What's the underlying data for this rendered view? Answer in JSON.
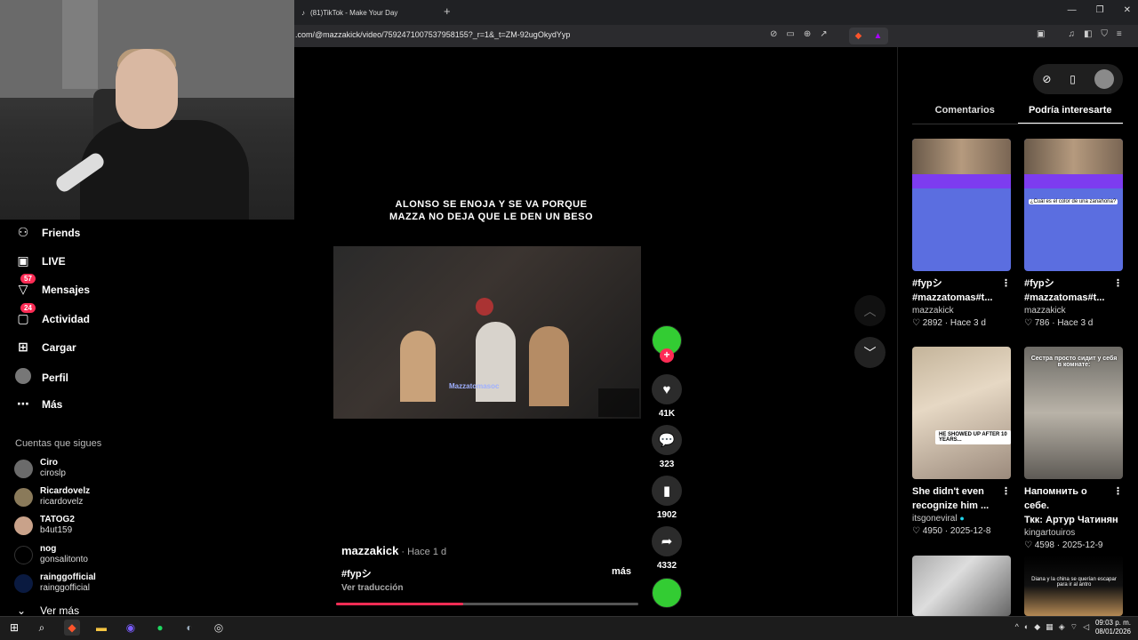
{
  "browser": {
    "tab_title": "(81)TikTok - Make Your Day",
    "url": ".com/@mazzakick/video/7592471007537958155?_r=1&_t=ZM-92ugOkydYyp"
  },
  "sidebar": {
    "items": [
      {
        "label": "Friends",
        "icon": "friends-icon"
      },
      {
        "label": "LIVE",
        "icon": "live-icon"
      },
      {
        "label": "Mensajes",
        "icon": "messages-icon",
        "badge": "57"
      },
      {
        "label": "Actividad",
        "icon": "activity-icon",
        "badge": "24"
      },
      {
        "label": "Cargar",
        "icon": "upload-icon"
      },
      {
        "label": "Perfil",
        "icon": "profile-icon"
      },
      {
        "label": "Más",
        "icon": "more-icon"
      }
    ],
    "following_title": "Cuentas que sigues",
    "following": [
      {
        "name": "Ciro",
        "handle": "ciroslp"
      },
      {
        "name": "Ricardovelz",
        "handle": "ricardovelz"
      },
      {
        "name": "TATOG2",
        "handle": "b4ut159"
      },
      {
        "name": "nog",
        "handle": "gonsalitonto"
      },
      {
        "name": "rainggofficial",
        "handle": "rainggofficial"
      }
    ],
    "see_more": "Ver más"
  },
  "video": {
    "caption_line1": "ALONSO SE ENOJA Y SE VA PORQUE",
    "caption_line2": "MAZZA NO DEJA QUE LE DEN UN BESO",
    "watermark": "Mazzatomasoc",
    "author": "mazzakick",
    "time": " · Hace 1 d",
    "description": "#fypシ",
    "more": "más",
    "translate": "Ver traducción",
    "progress": 0.42
  },
  "actions": {
    "likes": "41K",
    "comments": "323",
    "saves": "1902",
    "shares": "4332"
  },
  "right_panel": {
    "tabs": [
      "Comentarios",
      "Podría interesarte"
    ],
    "active_tab": 1,
    "cards": [
      {
        "title1": "#fypシ",
        "title2": "#mazzatomas#t...",
        "author": "mazzakick",
        "likes": "2892",
        "date": "Hace 3 d"
      },
      {
        "title1": "#fypシ",
        "title2": "#mazzatomas#t...",
        "author": "mazzakick",
        "likes": "786",
        "date": "Hace 3 d",
        "thumb_text": "¿Cuál es el color de una zanahoria?"
      },
      {
        "title1": "She didn't even",
        "title2": "recognize him ...",
        "author": "itsgoneviral",
        "likes": "4950",
        "date": "2025-12-8",
        "thumb_text": "HE SHOWED UP AFTER 10 YEARS..."
      },
      {
        "title1": "Напомнить о себе.",
        "title2": "Ткк: Артур Чатинян",
        "author": "kingartouiros",
        "likes": "4598",
        "date": "2025-12-9",
        "thumb_text": "Сестра просто сидит у себя в комнате:"
      },
      {
        "thumb_text": "Diana y la china se querían escapar para ir al antro"
      }
    ]
  },
  "taskbar": {
    "time": "09:03 p. m.",
    "date": "08/01/2026"
  }
}
